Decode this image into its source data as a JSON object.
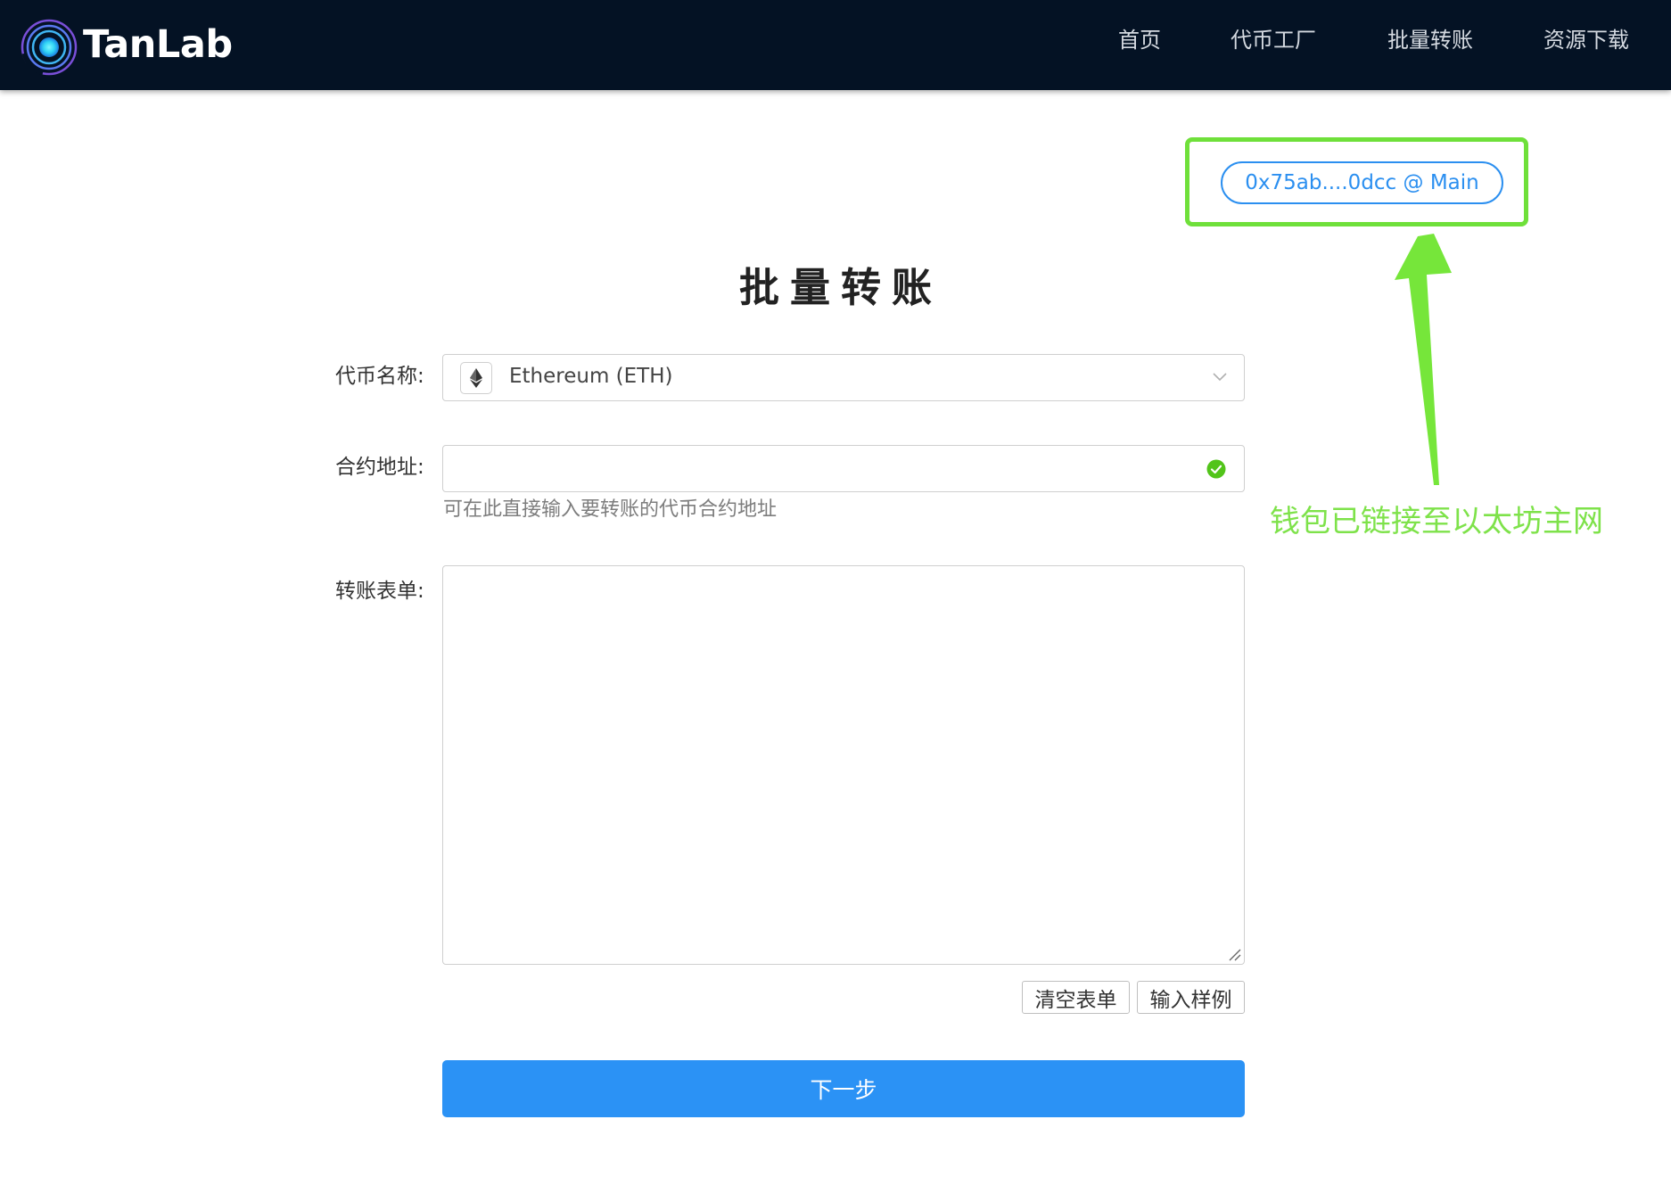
{
  "brand": {
    "name": "TanLab",
    "logo_icon": "concentric-circles-logo"
  },
  "nav": {
    "items": [
      "首页",
      "代币工厂",
      "批量转账",
      "资源下载"
    ]
  },
  "wallet": {
    "label": "0x75ab....0dcc @ Main"
  },
  "annotation": {
    "text": "钱包已链接至以太坊主网",
    "color": "#7ee24a"
  },
  "page": {
    "title": "批量转账"
  },
  "form": {
    "token": {
      "label": "代币名称:",
      "value": "Ethereum (ETH)",
      "icon": "ethereum-icon"
    },
    "contract": {
      "label": "合约地址:",
      "value": "",
      "help": "可在此直接输入要转账的代币合约地址",
      "status_icon": "check-circle-icon"
    },
    "list": {
      "label": "转账表单:",
      "value": ""
    },
    "buttons": {
      "clear": "清空表单",
      "example": "输入样例",
      "next": "下一步"
    }
  },
  "colors": {
    "navbar": "#041224",
    "accent": "#2b8ff0",
    "primary": "#2b92f5",
    "success": "#52c41a",
    "highlight": "#6fe03a"
  }
}
